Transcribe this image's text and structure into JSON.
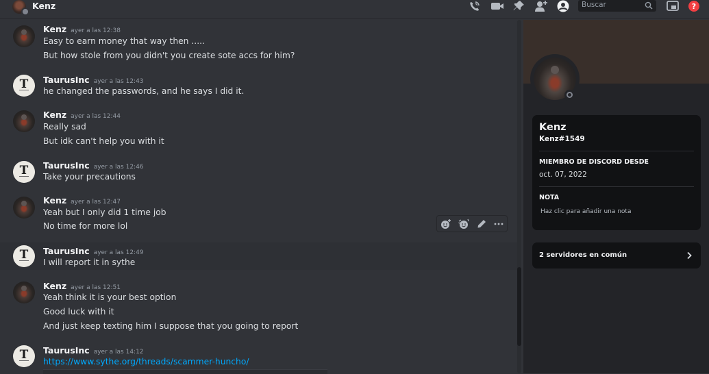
{
  "header": {
    "title": "Kenz",
    "search_placeholder": "Buscar",
    "icons": [
      "call-icon",
      "video-icon",
      "pin-icon",
      "add-friend-icon",
      "profile-toggle-icon",
      "search-icon",
      "inbox-icon",
      "help-icon"
    ]
  },
  "messages": [
    {
      "author": "Kenz",
      "avatar": "kenz",
      "time": "ayer a las 12:38",
      "lines": [
        "Easy to earn money that way then .....",
        "But how stole from you didn't  you create sote accs for him?"
      ]
    },
    {
      "author": "TaurusInc",
      "avatar": "taurus",
      "time": "ayer a las 12:43",
      "lines": [
        "he changed the passwords, and he says I did it."
      ]
    },
    {
      "author": "Kenz",
      "avatar": "kenz",
      "time": "ayer a las 12:44",
      "lines": [
        "Really sad",
        "But idk can't help you with it"
      ]
    },
    {
      "author": "TaurusInc",
      "avatar": "taurus",
      "time": "ayer a las 12:46",
      "lines": [
        "Take your precautions"
      ]
    },
    {
      "author": "Kenz",
      "avatar": "kenz",
      "time": "ayer a las 12:47",
      "lines": [
        "Yeah but I only did 1 time job",
        "No time for more lol"
      ]
    },
    {
      "author": "TaurusInc",
      "avatar": "taurus",
      "time": "ayer a las 12:49",
      "lines": [
        "I will report it in sythe"
      ]
    },
    {
      "author": "Kenz",
      "avatar": "kenz",
      "time": "ayer a las 12:51",
      "lines": [
        "Yeah think it is your best option",
        "Good luck with it",
        "And just keep texting him I suppose that you going to report"
      ]
    },
    {
      "author": "TaurusInc",
      "avatar": "taurus",
      "time": "ayer a las 14:12",
      "lines": [
        "https://www.sythe.org/threads/scammer-huncho/"
      ]
    }
  ],
  "avatar_letter": "T",
  "hover_toolbar": [
    "add-reaction-icon",
    "super-reaction-icon",
    "edit-icon",
    "more-icon"
  ],
  "profile": {
    "name": "Kenz",
    "tag": "Kenz#1549",
    "member_since_heading": "MIEMBRO DE DISCORD DESDE",
    "member_since": "oct. 07, 2022",
    "note_heading": "NOTA",
    "note_placeholder": "Haz clic para añadir una nota",
    "mutual_servers": "2 servidores en común",
    "status": "offline"
  },
  "colors": {
    "link": "#00a8fc",
    "background": "#313338",
    "panel": "#232428",
    "card": "#111214"
  }
}
